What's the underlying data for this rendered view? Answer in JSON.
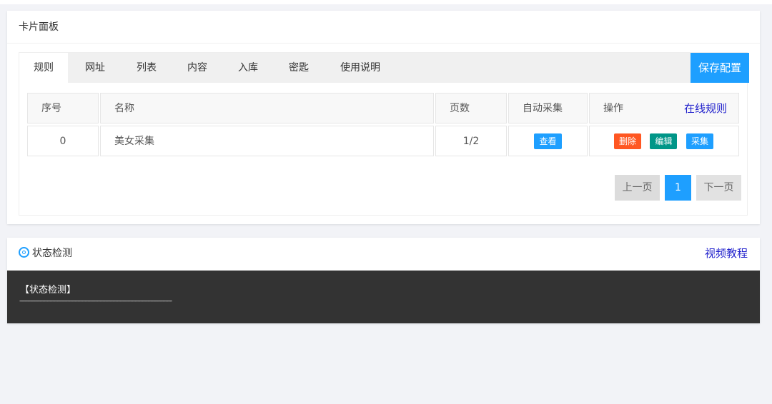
{
  "card1": {
    "title": "卡片面板",
    "tabs": [
      {
        "label": "规则"
      },
      {
        "label": "网址"
      },
      {
        "label": "列表"
      },
      {
        "label": "内容"
      },
      {
        "label": "入库"
      },
      {
        "label": "密匙"
      },
      {
        "label": "使用说明"
      }
    ],
    "save_label": "保存配置",
    "table": {
      "headers": {
        "index": "序号",
        "name": "名称",
        "pages": "页数",
        "auto": "自动采集",
        "ops": "操作",
        "online": "在线规则"
      },
      "rows": [
        {
          "index": "0",
          "name": "美女采集",
          "pages": "1/2",
          "view": "查看",
          "delete": "删除",
          "edit": "编辑",
          "collect": "采集"
        }
      ]
    },
    "pager": {
      "prev": "上一页",
      "current": "1",
      "next": "下一页"
    }
  },
  "card2": {
    "title": "状态检测",
    "video_link": "视频教程",
    "console_title": "【状态检测】",
    "console_line": "--------------------------------------------------------------------------------------------------------"
  },
  "colors": {
    "accent": "#1e9fff",
    "danger": "#ff5722",
    "success": "#009688",
    "link": "#2020cc",
    "console_bg": "#333333"
  }
}
